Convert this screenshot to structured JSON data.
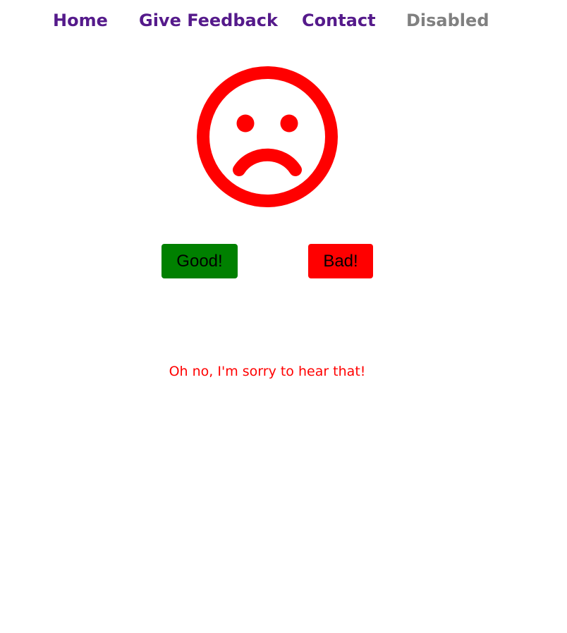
{
  "nav": {
    "items": [
      {
        "label": "Home",
        "state": "enabled"
      },
      {
        "label": "Give Feedback",
        "state": "enabled"
      },
      {
        "label": "Contact",
        "state": "enabled"
      },
      {
        "label": "Disabled",
        "state": "disabled"
      }
    ]
  },
  "face": {
    "icon": "sad-face-icon",
    "color": "#ff0000"
  },
  "buttons": {
    "good_label": "Good!",
    "good_color": "#008000",
    "bad_label": "Bad!",
    "bad_color": "#ff0000"
  },
  "message": {
    "text": "Oh no, I'm sorry to hear that!",
    "color": "#ff0000"
  },
  "colors": {
    "link": "#551a8b",
    "disabled": "#808080"
  }
}
